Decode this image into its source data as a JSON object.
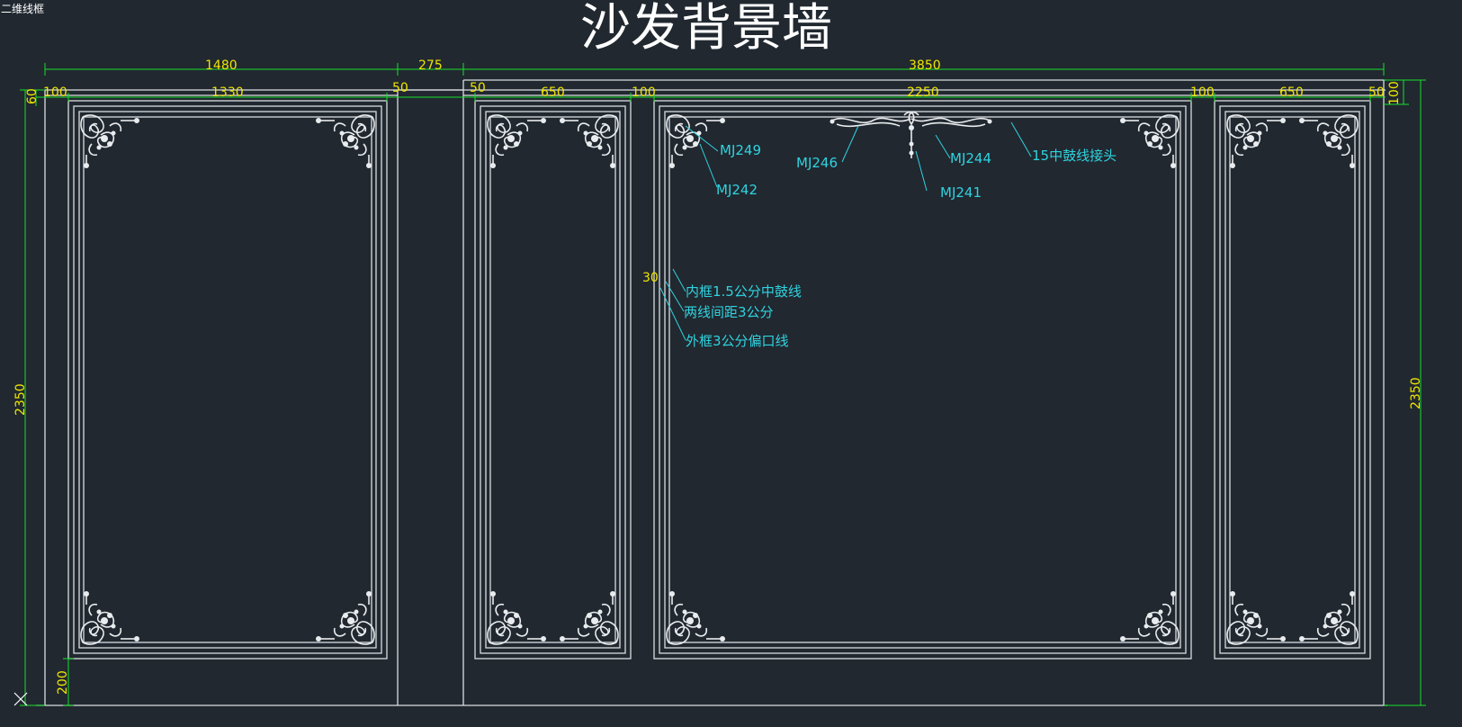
{
  "viewport_label": "二维线框",
  "title": "沙发背景墙",
  "dimensions": {
    "top_overall": [
      "1480",
      "275",
      "3850"
    ],
    "top_segments": [
      "100",
      "1330",
      "50",
      "50",
      "650",
      "100",
      "2250",
      "100",
      "650",
      "50"
    ],
    "left_60": "60",
    "right_100": "100",
    "left_height": "2350",
    "right_height": "2350",
    "base_200": "200",
    "gap_30": "30"
  },
  "callouts": {
    "mj249": "MJ249",
    "mj242": "MJ242",
    "mj246": "MJ246",
    "mj241": "MJ241",
    "mj244": "MJ244",
    "joint": "15中鼓线接头",
    "inner_frame": "内框1.5公分中鼓线",
    "line_spacing": "两线间距3公分",
    "outer_frame": "外框3公分偏口线"
  },
  "colors": {
    "background": "#212830",
    "dimension_text": "#f0e600",
    "dimension_line": "#18e02a",
    "callout": "#2fd3df",
    "wall_line": "#d9dde0"
  }
}
